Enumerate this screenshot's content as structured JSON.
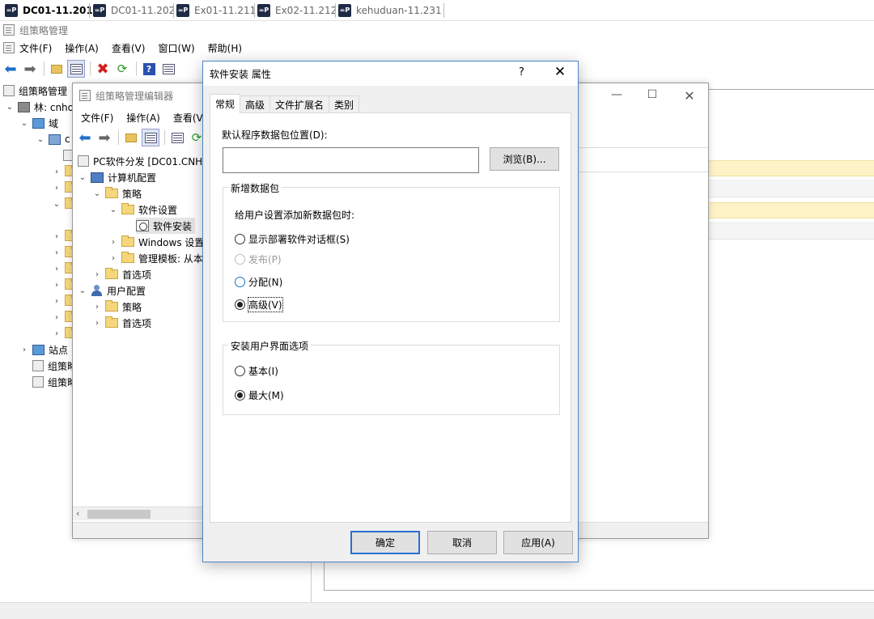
{
  "vm_tabs": [
    {
      "label": "DC01-11.201",
      "active": true
    },
    {
      "label": "DC01-11.202",
      "active": false
    },
    {
      "label": "Ex01-11.211",
      "active": false
    },
    {
      "label": "Ex02-11.212",
      "active": false
    },
    {
      "label": "kehuduan-11.231",
      "active": false
    }
  ],
  "main_window": {
    "title": "组策略管理",
    "menu": [
      "文件(F)",
      "操作(A)",
      "查看(V)",
      "窗口(W)",
      "帮助(H)"
    ],
    "tree": [
      {
        "label": "组策略管理"
      },
      {
        "label": "林: cnho"
      },
      {
        "label": "域"
      },
      {
        "label": "c"
      },
      {
        "label": "站点"
      },
      {
        "label": "组策略"
      },
      {
        "label": "组策略"
      }
    ]
  },
  "editor_window": {
    "title": "组策略管理编辑器",
    "menu": [
      "文件(F)",
      "操作(A)",
      "查看(V)"
    ],
    "tree": [
      {
        "label": "PC软件分发 [DC01.CNHO"
      },
      {
        "label": "计算机配置"
      },
      {
        "label": "策略"
      },
      {
        "label": "软件设置"
      },
      {
        "label": "软件安装",
        "selected": true
      },
      {
        "label": "Windows 设置"
      },
      {
        "label": "管理模板: 从本"
      },
      {
        "label": "首选项"
      },
      {
        "label": "用户配置"
      },
      {
        "label": "策略"
      },
      {
        "label": "首选项"
      }
    ]
  },
  "dialog": {
    "title": "软件安装 属性",
    "help": "?",
    "close": "✕",
    "tabs": [
      "常规",
      "高级",
      "文件扩展名",
      "类别"
    ],
    "default_path_label": "默认程序数据包位置(D):",
    "default_path_value": "",
    "browse_label": "浏览(B)...",
    "new_package_group": "新增数据包",
    "new_package_prompt": "给用户设置添加新数据包时:",
    "new_package_options": [
      {
        "label": "显示部署软件对话框(S)",
        "checked": false,
        "disabled": false
      },
      {
        "label": "发布(P)",
        "checked": false,
        "disabled": true
      },
      {
        "label": "分配(N)",
        "checked": false,
        "disabled": false
      },
      {
        "label": "高级(V)",
        "checked": true,
        "disabled": false
      }
    ],
    "ui_group": "安装用户界面选项",
    "ui_options": [
      {
        "label": "基本(I)",
        "checked": false
      },
      {
        "label": "最大(M)",
        "checked": true
      }
    ],
    "ok_label": "确定",
    "cancel_label": "取消",
    "apply_label": "应用(A)"
  },
  "colors": {
    "accent": "#2a6fd0",
    "dialog_border": "#4a86c8",
    "highlight_row": "#fdf3c6"
  }
}
